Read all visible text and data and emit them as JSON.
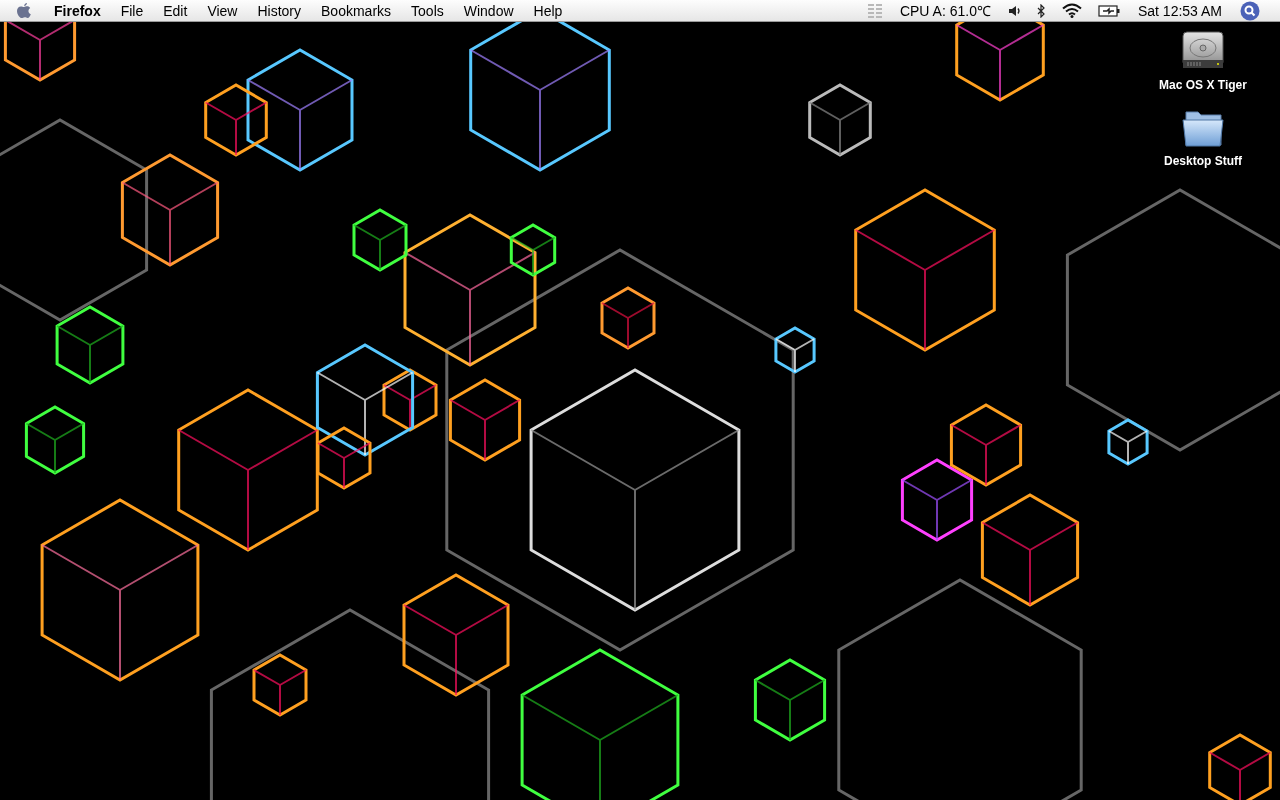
{
  "menubar": {
    "app_name": "Firefox",
    "menus": [
      "File",
      "Edit",
      "View",
      "History",
      "Bookmarks",
      "Tools",
      "Window",
      "Help"
    ],
    "cpu_reading": "CPU A: 61.0℃",
    "clock": "Sat 12:53 AM"
  },
  "desktop_icons": [
    {
      "label": "Mac OS X Tiger",
      "kind": "drive"
    },
    {
      "label": "Desktop Stuff",
      "kind": "folder"
    }
  ]
}
